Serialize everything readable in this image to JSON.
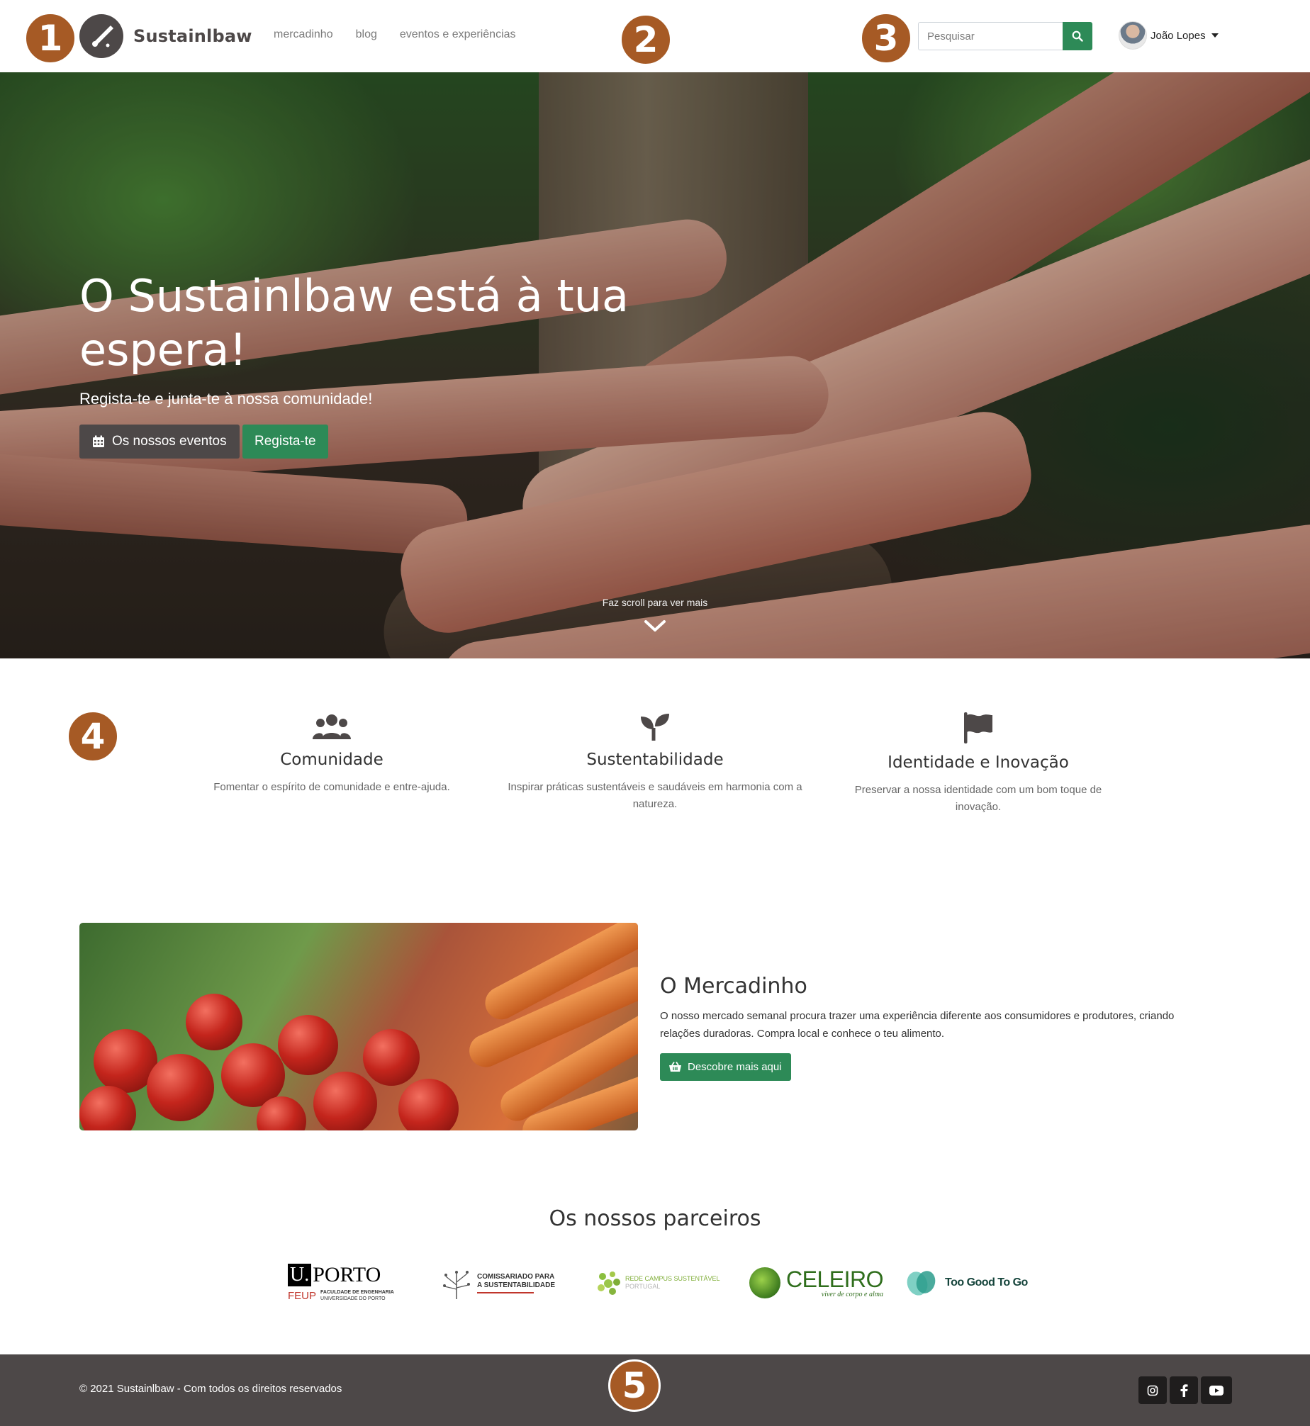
{
  "navbar": {
    "brand": "Sustainlbaw",
    "links": [
      "mercadinho",
      "blog",
      "eventos e experiências"
    ],
    "search_placeholder": "Pesquisar",
    "user_name": "João Lopes"
  },
  "hero": {
    "title": "O Sustainlbaw está à tua espera!",
    "subtitle": "Regista-te e junta-te à nossa comunidade!",
    "events_button": "Os nossos eventos",
    "register_button": "Regista-te",
    "scroll_hint": "Faz scroll para ver mais"
  },
  "values": [
    {
      "icon": "users-icon",
      "title": "Comunidade",
      "text": "Fomentar o espírito de comunidade e entre-ajuda."
    },
    {
      "icon": "seedling-icon",
      "title": "Sustentabilidade",
      "text": "Inspirar práticas sustentáveis e saudáveis em harmonia com a natureza."
    },
    {
      "icon": "flag-icon",
      "title": "Identidade e Inovação",
      "text": "Preservar a nossa identidade com um bom toque de inovação."
    }
  ],
  "market": {
    "title": "O Mercadinho",
    "text": "O nosso mercado semanal procura trazer uma experiência diferente aos consumidores e produtores, criando relações duradoras. Compra local e conhece o teu alimento.",
    "button": "Descobre mais aqui"
  },
  "partners": {
    "title": "Os nossos parceiros",
    "logos": [
      {
        "name": "uporto-feup-logo",
        "line1": "U.PORTO",
        "line2": "FEUP",
        "line3": "FACULDADE DE ENGENHARIA",
        "line4": "UNIVERSIDADE DO PORTO"
      },
      {
        "name": "comissariado-logo",
        "line1": "COMISSARIADO PARA",
        "line2": "A SUSTENTABILIDADE"
      },
      {
        "name": "rede-campus-logo",
        "line1": "REDE CAMPUS SUSTENTÁVEL",
        "line2": "PORTUGAL"
      },
      {
        "name": "celeiro-logo",
        "line1": "CELEIRO",
        "line2": "viver de corpo e alma"
      },
      {
        "name": "too-good-to-go-logo",
        "line1": "Too Good To Go"
      }
    ]
  },
  "footer": {
    "copyright": "© 2021 Sustainlbaw - Com todos os direitos reservados",
    "social": [
      "instagram-icon",
      "facebook-icon",
      "youtube-icon"
    ]
  },
  "markers": [
    "1",
    "2",
    "3",
    "4",
    "5"
  ],
  "colors": {
    "brand_dark": "#4d4848",
    "accent_green": "#2d8a57",
    "marker_orange": "#a65a25"
  }
}
